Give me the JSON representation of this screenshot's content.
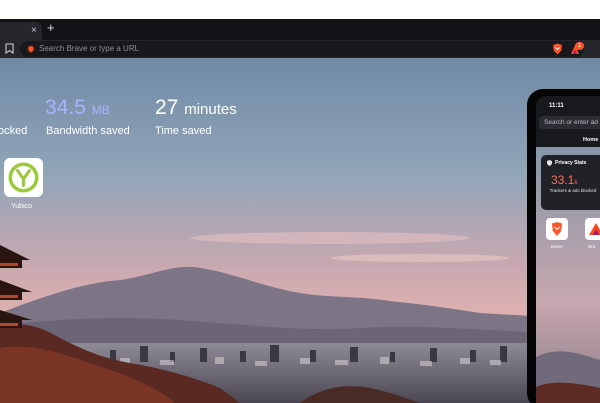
{
  "browser": {
    "tab_close_glyph": "×",
    "new_tab_glyph": "+",
    "url_placeholder": "Search Brave or type a URL",
    "rewards_badge": "1",
    "accent_color": "#fb542b"
  },
  "stats": {
    "trackers_label": "ocked",
    "bandwidth_value": "34.5",
    "bandwidth_unit": "MB",
    "bandwidth_label": "Bandwidth saved",
    "time_value": "27",
    "time_unit": "minutes",
    "time_label": "Time saved",
    "bandwidth_color": "#a8b3ff"
  },
  "top_sites": [
    {
      "label": "Yubico",
      "icon": "yubico-icon"
    }
  ],
  "phone": {
    "time": "11:11",
    "search_placeholder": "Search or enter ad",
    "home_label": "Home",
    "privacy_stats_title": "Privacy Stats",
    "trackers_value": "33.1",
    "trackers_unit": "k",
    "trackers_desc": "Trackers & ads blocked",
    "apps": [
      {
        "label": "Brave",
        "icon": "brave-lion-icon"
      },
      {
        "label": "Bra",
        "icon": "bat-triangle-icon"
      }
    ]
  }
}
